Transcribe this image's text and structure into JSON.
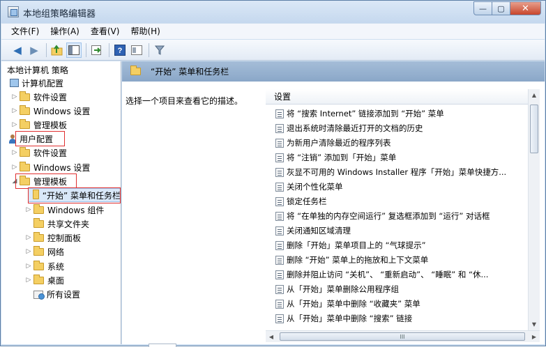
{
  "window": {
    "title": "本地组策略编辑器"
  },
  "window_buttons": {
    "minimize": "—",
    "maximize": "▢",
    "close": "✕"
  },
  "menu": [
    {
      "label": "文件(F)"
    },
    {
      "label": "操作(A)"
    },
    {
      "label": "查看(V)"
    },
    {
      "label": "帮助(H)"
    }
  ],
  "toolbar": {
    "icons": [
      "back-arrow-icon",
      "forward-arrow-icon",
      "up-folder-icon",
      "show-hide-tree-icon",
      "export-list-icon",
      "help-icon",
      "properties-icon",
      "filter-icon"
    ]
  },
  "tree": {
    "root": "本地计算机 策略",
    "computer_config": "计算机配置",
    "computer_children": [
      "软件设置",
      "Windows 设置",
      "管理模板"
    ],
    "user_config": "用户配置",
    "user_children": [
      "软件设置",
      "Windows 设置",
      "管理模板"
    ],
    "admin_templates_children": [
      "“开始” 菜单和任务栏",
      "Windows 组件",
      "共享文件夹",
      "控制面板",
      "网络",
      "系统",
      "桌面",
      "所有设置"
    ]
  },
  "right": {
    "header_title": "“开始” 菜单和任务栏",
    "description": "选择一个项目来查看它的描述。",
    "column_header": "设置",
    "items": [
      "将 “搜索 Internet” 链接添加到 “开始” 菜单",
      "退出系统时清除最近打开的文档的历史",
      "为新用户清除最近的程序列表",
      "将 “注销” 添加到「开始」菜单",
      "灰显不可用的 Windows Installer 程序「开始」菜单快捷方...",
      "关闭个性化菜单",
      "锁定任务栏",
      "将 “在单独的内存空间运行” 复选框添加到 “运行” 对话框",
      "关闭通知区域清理",
      "删除「开始」菜单项目上的 “气球提示”",
      "删除 “开始” 菜单上的拖放和上下文菜单",
      "删除并阻止访问 “关机”、 “重新启动”、 “睡眠” 和 “休...",
      "从「开始」菜单删除公用程序组",
      "从「开始」菜单中删除 “收藏夹” 菜单",
      "从「开始」菜单中删除 “搜索” 链接"
    ]
  },
  "scroll": {
    "h_thumb_grip": "III"
  },
  "colors": {
    "highlight_box": "#e02f2f",
    "header_blue": "#8aa7c8",
    "folder_yellow": "#f4cf63"
  }
}
